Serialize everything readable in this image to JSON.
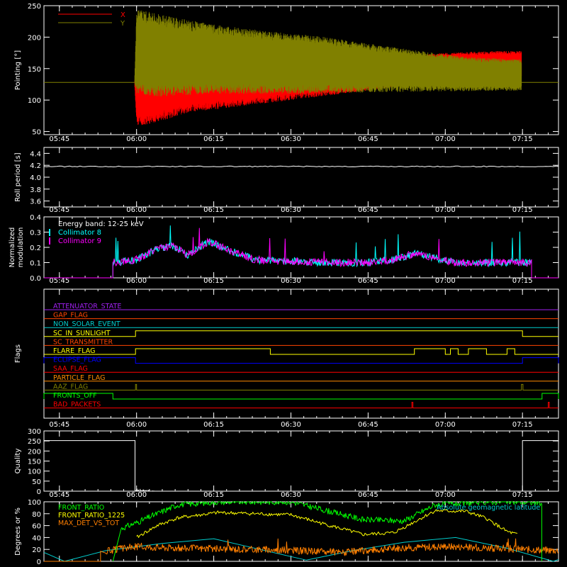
{
  "chart_data": [
    {
      "type": "line",
      "ylabel": "Pointing [°]",
      "ylim": [
        45,
        250
      ],
      "yticks": [
        50,
        100,
        150,
        200,
        250
      ],
      "xticks": [
        "05:45",
        "06:00",
        "06:15",
        "06:30",
        "06:45",
        "07:00",
        "07:15"
      ],
      "xlim_minutes": [
        342,
        442
      ],
      "legend_position": "top-left",
      "series": [
        {
          "name": "X",
          "color": "#ff0000",
          "upper_envelope": [
            [
              359.6,
              128
            ],
            [
              360,
              170
            ],
            [
              370,
              175
            ],
            [
              390,
              172
            ],
            [
              405,
              172
            ],
            [
              413,
              170
            ],
            [
              420,
              175
            ],
            [
              430,
              178
            ],
            [
              434.8,
              178
            ]
          ],
          "lower_envelope": [
            [
              359.6,
              128
            ],
            [
              360,
              60
            ],
            [
              362,
              60
            ],
            [
              370,
              80
            ],
            [
              380,
              90
            ],
            [
              390,
              100
            ],
            [
              400,
              110
            ],
            [
              410,
              120
            ],
            [
              420,
              130
            ],
            [
              430,
              134
            ],
            [
              434.8,
              137
            ]
          ]
        },
        {
          "name": "Y",
          "color": "#808000",
          "upper_envelope": [
            [
              359.6,
              128
            ],
            [
              360,
              245
            ],
            [
              365,
              235
            ],
            [
              375,
              220
            ],
            [
              385,
              210
            ],
            [
              395,
              202
            ],
            [
              405,
              190
            ],
            [
              415,
              178
            ],
            [
              425,
              168
            ],
            [
              434.8,
              165
            ]
          ],
          "lower_envelope": [
            [
              359.6,
              128
            ],
            [
              360,
              110
            ],
            [
              365,
              105
            ],
            [
              375,
              110
            ],
            [
              390,
              110
            ],
            [
              405,
              112
            ],
            [
              420,
              114
            ],
            [
              434.8,
              115
            ]
          ]
        }
      ],
      "baseline_value": 128
    },
    {
      "type": "line",
      "ylabel": "Roll period [s]",
      "ylim": [
        3.5,
        4.5
      ],
      "yticks": [
        3.6,
        3.8,
        4.0,
        4.2,
        4.4
      ],
      "xticks": [
        "05:45",
        "06:00",
        "06:15",
        "06:30",
        "06:45",
        "07:00",
        "07:15"
      ],
      "series": [
        {
          "color": "#ffffff",
          "value": 4.18
        }
      ]
    },
    {
      "type": "line",
      "ylabel": "Normalized\nmodulation",
      "ylim": [
        0,
        0.4
      ],
      "yticks": [
        0.0,
        0.1,
        0.2,
        0.3,
        0.4
      ],
      "xticks": [
        "05:45",
        "06:00",
        "06:15",
        "06:30",
        "06:45",
        "07:00",
        "07:15"
      ],
      "annotation": "Energy band: 12-25 keV",
      "legend_position": "top-left",
      "series": [
        {
          "name": "Collimator 8",
          "color": "#00ffff",
          "profile": [
            [
              355.4,
              0.1
            ],
            [
              360,
              0.12
            ],
            [
              364,
              0.19
            ],
            [
              367,
              0.21
            ],
            [
              370,
              0.15
            ],
            [
              374,
              0.24
            ],
            [
              378,
              0.18
            ],
            [
              383,
              0.12
            ],
            [
              388,
              0.11
            ],
            [
              400,
              0.1
            ],
            [
              405,
              0.1
            ],
            [
              410,
              0.12
            ],
            [
              414,
              0.16
            ],
            [
              418,
              0.13
            ],
            [
              422,
              0.1
            ],
            [
              430,
              0.1
            ],
            [
              436.8,
              0.1
            ]
          ]
        },
        {
          "name": "Collimator 9",
          "color": "#ff00ff",
          "profile": [
            [
              355.4,
              0.1
            ],
            [
              360,
              0.12
            ],
            [
              364,
              0.19
            ],
            [
              367,
              0.21
            ],
            [
              370,
              0.15
            ],
            [
              374,
              0.24
            ],
            [
              378,
              0.18
            ],
            [
              383,
              0.12
            ],
            [
              388,
              0.11
            ],
            [
              400,
              0.1
            ],
            [
              405,
              0.1
            ],
            [
              410,
              0.12
            ],
            [
              414,
              0.16
            ],
            [
              418,
              0.13
            ],
            [
              422,
              0.1
            ],
            [
              430,
              0.1
            ],
            [
              436.8,
              0.1
            ]
          ]
        }
      ]
    },
    {
      "type": "line",
      "ylabel": "Flags",
      "xticks": [
        "05:45",
        "06:00",
        "06:15",
        "06:30",
        "06:45",
        "07:00",
        "07:15"
      ],
      "flags": [
        {
          "name": "ATTENUATOR_STATE",
          "color": "#a020f0",
          "segments": []
        },
        {
          "name": "GAP_FLAG",
          "color": "#ff4500",
          "segments": []
        },
        {
          "name": "NON_SOLAR_EVENT",
          "color": "#00cdcd",
          "segments": []
        },
        {
          "name": "SC_IN_SUNLIGHT",
          "color": "#ffff00",
          "segments": [
            [
              359.8,
              435
            ]
          ]
        },
        {
          "name": "SC_TRANSMITTER",
          "color": "#ff4500",
          "segments": []
        },
        {
          "name": "FLARE_FLAG",
          "color": "#ffff00",
          "segments": [
            [
              359.8,
              386
            ],
            [
              414,
              420
            ],
            [
              421,
              422.5
            ],
            [
              424.5,
              428
            ],
            [
              432,
              433.5
            ]
          ]
        },
        {
          "name": "ECLIPSE_FLAG",
          "color": "#0000ff",
          "segments": [
            [
              342,
              359.8
            ],
            [
              435,
              442
            ]
          ]
        },
        {
          "name": "SAA_FLAG",
          "color": "#ff0000",
          "segments": []
        },
        {
          "name": "PARTICLE_FLAG",
          "color": "#ff8c00",
          "segments": []
        },
        {
          "name": "AAZ_FLAG",
          "color": "#808000",
          "segments": [
            [
              359.8,
              360
            ],
            [
              434.8,
              435.1
            ]
          ]
        },
        {
          "name": "FRONTS_OFF",
          "color": "#00ff00",
          "segments": [
            [
              342,
              355.4
            ],
            [
              438.8,
              442
            ]
          ]
        },
        {
          "name": "BAD_PACKETS",
          "color": "#ff0000",
          "segments": [
            [
              413.5,
              413.6
            ],
            [
              440,
              440.1
            ]
          ]
        }
      ]
    },
    {
      "type": "line",
      "ylabel": "Quality",
      "ylim": [
        0,
        300
      ],
      "yticks": [
        0,
        50,
        100,
        150,
        200,
        250,
        300
      ],
      "xticks": [
        "05:45",
        "06:00",
        "06:15",
        "06:30",
        "06:45",
        "07:00",
        "07:15"
      ],
      "series": [
        {
          "color": "#ffffff",
          "points": [
            [
              342,
              252
            ],
            [
              359.7,
              252
            ],
            [
              359.7,
              0
            ],
            [
              435,
              0
            ],
            [
              435,
              252
            ],
            [
              442,
              252
            ]
          ]
        }
      ]
    },
    {
      "type": "line",
      "ylabel": "Degrees or %",
      "ylim": [
        0,
        100
      ],
      "yticks": [
        0,
        20,
        40,
        60,
        80,
        100
      ],
      "legend_position": "top-left",
      "series": [
        {
          "name": "FRONT_RATIO",
          "color": "#00ff00",
          "points": [
            [
              355.4,
              0
            ],
            [
              357,
              55
            ],
            [
              360,
              65
            ],
            [
              364,
              80
            ],
            [
              368,
              95
            ],
            [
              376,
              100
            ],
            [
              390,
              100
            ],
            [
              404,
              70
            ],
            [
              412,
              68
            ],
            [
              418,
              95
            ],
            [
              428,
              100
            ],
            [
              434,
              100
            ],
            [
              438.8,
              98
            ],
            [
              438.8,
              0
            ]
          ]
        },
        {
          "name": "FRONT_RATIO_1225",
          "color": "#ffff00",
          "points": [
            [
              360,
              40
            ],
            [
              364,
              60
            ],
            [
              368,
              73
            ],
            [
              376,
              82
            ],
            [
              390,
              78
            ],
            [
              404,
              45
            ],
            [
              410,
              48
            ],
            [
              418,
              85
            ],
            [
              424,
              84
            ],
            [
              428,
              72
            ],
            [
              432,
              50
            ],
            [
              434,
              45
            ]
          ]
        },
        {
          "name": "MAX_DET_VS_TOT",
          "color": "#ff7f00",
          "points": [
            [
              342,
              0
            ],
            [
              353,
              0
            ],
            [
              354,
              17
            ],
            [
              360,
              25
            ],
            [
              370,
              22
            ],
            [
              385,
              20
            ],
            [
              400,
              15
            ],
            [
              410,
              22
            ],
            [
              420,
              25
            ],
            [
              430,
              22
            ],
            [
              436,
              20
            ],
            [
              442,
              18
            ]
          ]
        },
        {
          "name": "Absolute geomagnetic latitude",
          "color": "#00cdcd",
          "points": [
            [
              342,
              15
            ],
            [
              346,
              0
            ],
            [
              354,
              18
            ],
            [
              365,
              30
            ],
            [
              375,
              38
            ],
            [
              384,
              20
            ],
            [
              393,
              2
            ],
            [
              402,
              18
            ],
            [
              412,
              32
            ],
            [
              422,
              40
            ],
            [
              432,
              22
            ],
            [
              441,
              0
            ],
            [
              442,
              3
            ]
          ]
        }
      ]
    }
  ]
}
